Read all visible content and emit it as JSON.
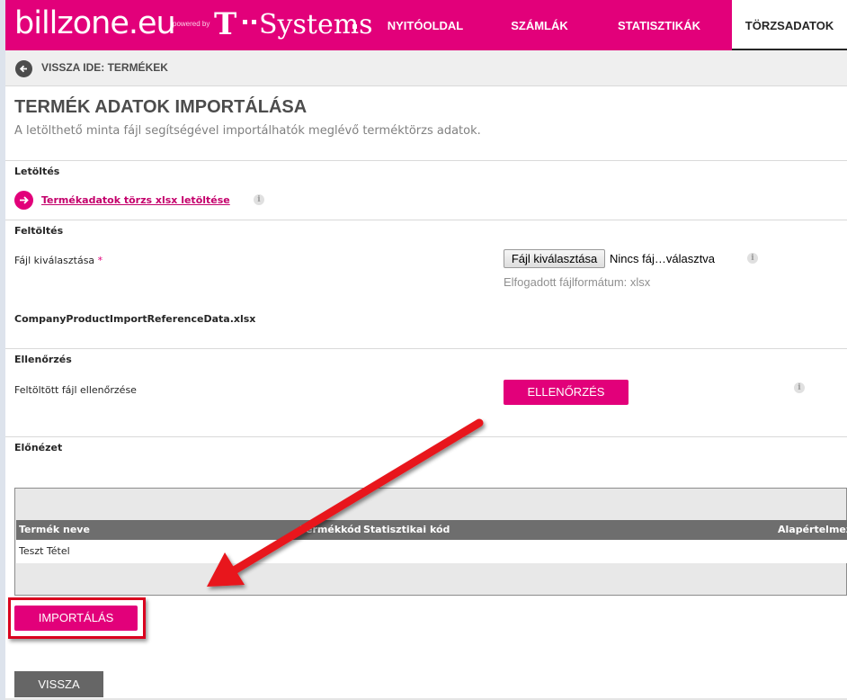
{
  "header": {
    "logo": "billzone.eu",
    "powered_by": "powered by",
    "partner_t": "T",
    "partner_name": "Systems",
    "nav": [
      {
        "label": "NYITÓOLDAL",
        "active": false
      },
      {
        "label": "SZÁMLÁK",
        "active": false
      },
      {
        "label": "STATISZTIKÁK",
        "active": false
      },
      {
        "label": "TÖRZSADATOK",
        "active": true
      }
    ],
    "brand_color": "#e2007a"
  },
  "breadcrumb": {
    "icon": "arrow-left-icon",
    "label": "VISSZA IDE: TERMÉKEK"
  },
  "page": {
    "title": "TERMÉK ADATOK IMPORTÁLÁSA",
    "subtitle": "A letölthető minta fájl segítségével importálhatók meglévő terméktörzs adatok."
  },
  "download": {
    "section_title": "Letöltés",
    "link_label": "Termékadatok törzs xlsx letöltése",
    "icon": "arrow-right-icon"
  },
  "upload": {
    "section_title": "Feltöltés",
    "field_label": "Fájl kiválasztása",
    "required_mark": "*",
    "button_label": "Fájl kiválasztása",
    "file_status": "Nincs fáj…választva",
    "accepted_format": "Elfogadott fájlformátum: xlsx",
    "uploaded_filename": "CompanyProductImportReferenceData.xlsx"
  },
  "check": {
    "section_title": "Ellenőrzés",
    "field_label": "Feltöltött fájl ellenőrzése",
    "button_label": "ELLENŐRZÉS"
  },
  "preview": {
    "section_title": "Előnézet",
    "columns": [
      "Termék neve",
      "Termékkód",
      "Statisztikai kód",
      "Alapértelmez"
    ],
    "rows": [
      [
        "Teszt Tétel",
        "",
        "",
        ""
      ]
    ]
  },
  "actions": {
    "import_label": "IMPORTÁLÁS",
    "back_label": "VISSZA"
  },
  "annotation": {
    "arrow_color": "#e8141c",
    "highlight_color": "#d9001e"
  }
}
